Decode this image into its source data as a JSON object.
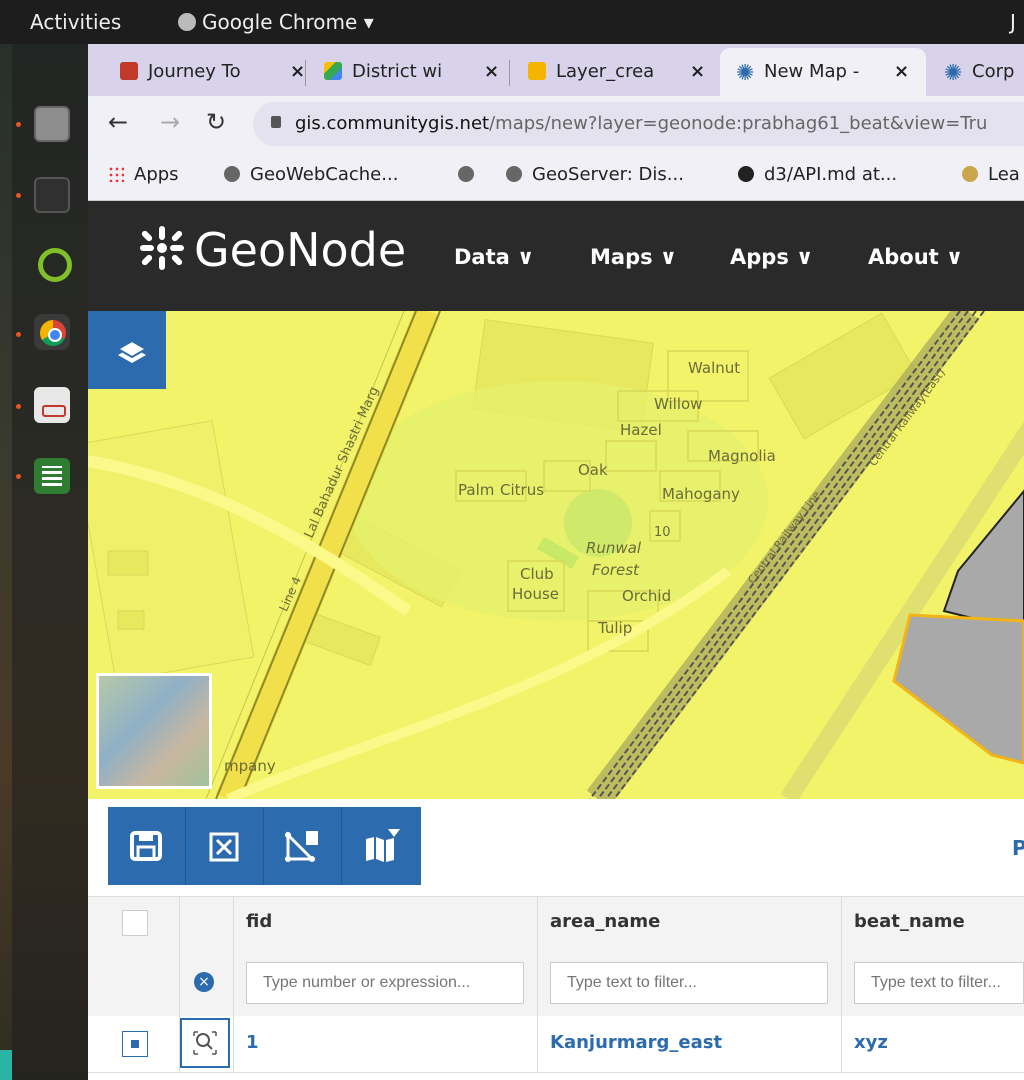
{
  "system": {
    "activities": "Activities",
    "app_menu": "Google Chrome ▾",
    "clock_fragment": "J"
  },
  "browser": {
    "tabs": [
      {
        "title": "Journey To",
        "close": "×",
        "icon": "shield-icon"
      },
      {
        "title": "District wi",
        "close": "×",
        "icon": "drive-icon"
      },
      {
        "title": "Layer_crea",
        "close": "×",
        "icon": "slides-icon"
      },
      {
        "title": "New Map -",
        "close": "×",
        "icon": "geonode-icon",
        "active": true
      },
      {
        "title": "Corp",
        "icon": "geonode-icon"
      }
    ],
    "url_host": "gis.communitygis.net",
    "url_path": "/maps/new?layer=geonode:prabhag61_beat&view=Tru",
    "bookmarks": [
      "Apps",
      "GeoWebCache...",
      "GeoServer: Dis...",
      "d3/API.md at...",
      "Lea"
    ]
  },
  "geonode": {
    "brand": "GeoNode",
    "nav": [
      "Data ∨",
      "Maps ∨",
      "Apps ∨",
      "About ∨"
    ]
  },
  "map": {
    "labels": [
      "Walnut",
      "Willow",
      "Hazel",
      "Magnolia",
      "Oak",
      "Palm",
      "Citrus",
      "Mahogany",
      "10",
      "Runwal",
      "Forest",
      "Club",
      "House",
      "Orchid",
      "Tulip",
      "Lal Bahadur Shastri Marg",
      "Line 4",
      "mpany",
      "Central Railway Line",
      "Central Railway(East)"
    ]
  },
  "table": {
    "pager_fragment": "P",
    "columns": [
      "fid",
      "area_name",
      "beat_name"
    ],
    "filter_placeholders": [
      "Type number or expression...",
      "Type text to filter...",
      "Type text to filter..."
    ],
    "rows": [
      {
        "fid": "1",
        "area_name": "Kanjurmarg_east",
        "beat_name": "xyz"
      }
    ]
  },
  "colors": {
    "accent": "#2c6bad",
    "map_fill": "#f3f36a",
    "header": "#2a2a2a"
  }
}
